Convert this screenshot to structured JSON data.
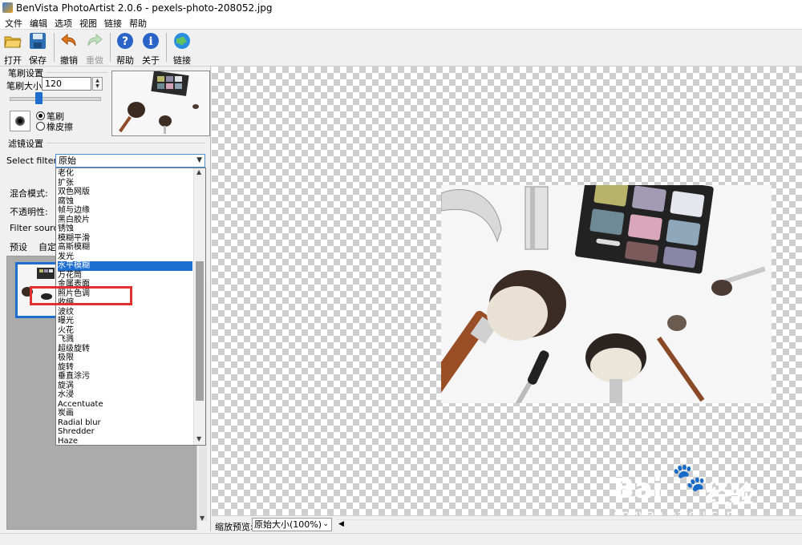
{
  "window": {
    "title": "BenVista PhotoArtist 2.0.6 - pexels-photo-208052.jpg"
  },
  "menu": [
    "文件",
    "编辑",
    "选项",
    "视图",
    "链接",
    "帮助"
  ],
  "toolbar": {
    "open": "打开",
    "save": "保存",
    "undo": "撤销",
    "redo": "重做",
    "help": "帮助",
    "about": "关于",
    "link": "链接"
  },
  "brush": {
    "group_title": "笔刷设置",
    "size_label": "笔刷大小:",
    "size_value": "120",
    "radio_brush": "笔刷",
    "radio_eraser": "橡皮擦"
  },
  "filter": {
    "group_title": "滤镜设置",
    "select_label": "Select filter:",
    "selected": "原始",
    "blend_label": "混合模式:",
    "opacity_label": "不透明性:",
    "source_label": "Filter source:",
    "options": [
      "老化",
      "扩张",
      "双色网版",
      "腐蚀",
      "帧与边缘",
      "黑白胶片",
      "锈蚀",
      "模糊平滑",
      "高斯模糊",
      "发光",
      "水平模糊",
      "万花筒",
      "金属表面",
      "照片色调",
      "收缩",
      "波纹",
      "曝光",
      "火花",
      "飞溅",
      "超级旋转",
      "极限",
      "旋转",
      "垂直涂污",
      "旋涡",
      "水浸",
      "Accentuate",
      "炭画",
      "Radial blur",
      "Shredder",
      "Haze"
    ],
    "highlighted_index": 10
  },
  "tabs": {
    "presets": "预设",
    "custom": "自定"
  },
  "bottom": {
    "zoom_label": "缩放预览:",
    "zoom_value": "原始大小(100%)"
  },
  "watermark": {
    "brand": "Bai",
    "brand2": "经验",
    "url": "jingyan.baidu.com"
  }
}
